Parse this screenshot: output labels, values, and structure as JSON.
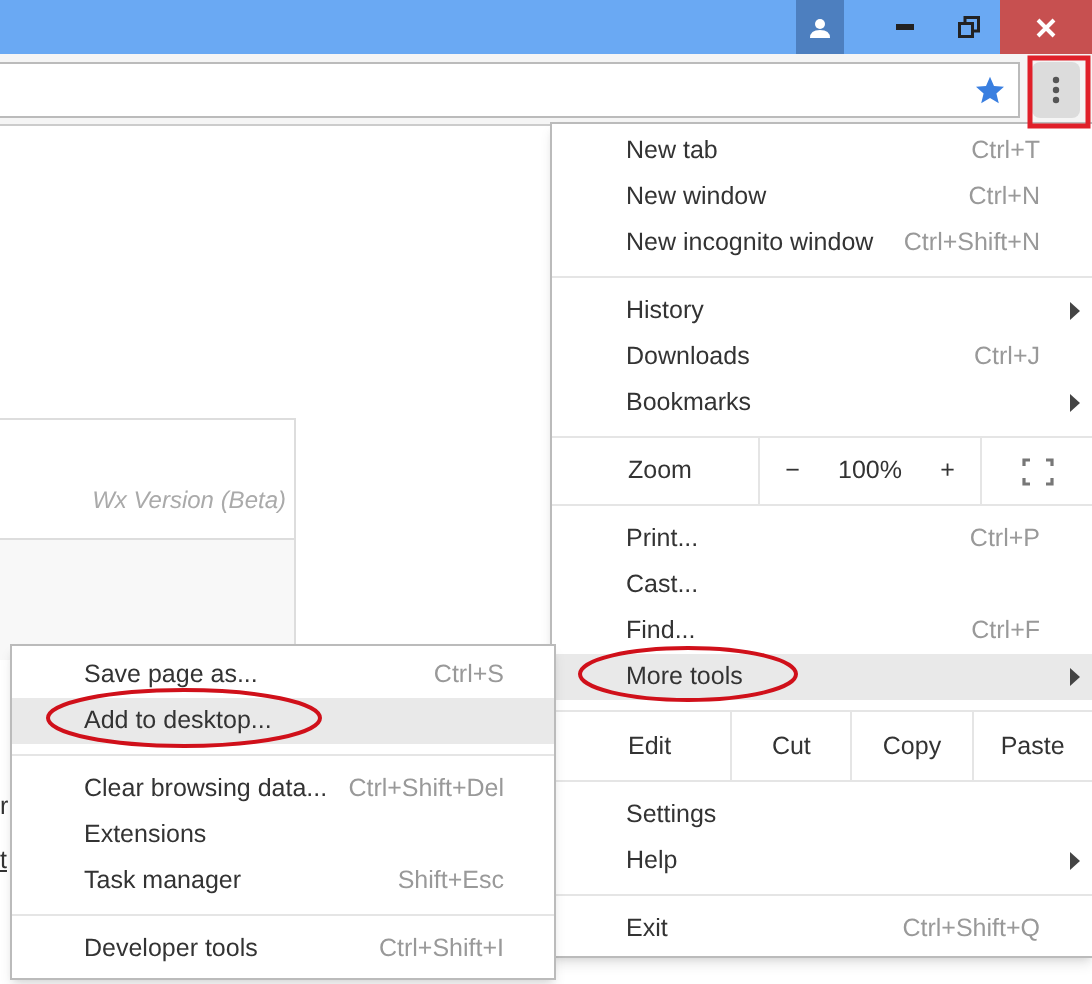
{
  "page": {
    "card_caption": "Wx Version (Beta)",
    "fragments": [
      {
        "text": "r",
        "kind": "text"
      },
      {
        "text": "t",
        "kind": "link"
      }
    ]
  },
  "menu": {
    "items": [
      {
        "kind": "item",
        "label": "New tab",
        "shortcut": "Ctrl+T",
        "submenu": false,
        "highlighted": false
      },
      {
        "kind": "item",
        "label": "New window",
        "shortcut": "Ctrl+N",
        "submenu": false,
        "highlighted": false
      },
      {
        "kind": "item",
        "label": "New incognito window",
        "shortcut": "Ctrl+Shift+N",
        "submenu": false,
        "highlighted": false
      },
      {
        "kind": "separator"
      },
      {
        "kind": "item",
        "label": "History",
        "submenu": true,
        "highlighted": false
      },
      {
        "kind": "item",
        "label": "Downloads",
        "shortcut": "Ctrl+J",
        "submenu": false,
        "highlighted": false
      },
      {
        "kind": "item",
        "label": "Bookmarks",
        "submenu": true,
        "highlighted": false
      },
      {
        "kind": "separator"
      },
      {
        "kind": "zoom",
        "label": "Zoom",
        "minus": "−",
        "value": "100%",
        "plus": "+"
      },
      {
        "kind": "separator"
      },
      {
        "kind": "item",
        "label": "Print...",
        "shortcut": "Ctrl+P",
        "submenu": false,
        "highlighted": false
      },
      {
        "kind": "item",
        "label": "Cast...",
        "submenu": false,
        "highlighted": false
      },
      {
        "kind": "item",
        "label": "Find...",
        "shortcut": "Ctrl+F",
        "submenu": false,
        "highlighted": false
      },
      {
        "kind": "item",
        "label": "More tools",
        "submenu": true,
        "highlighted": true
      },
      {
        "kind": "separator"
      },
      {
        "kind": "edit",
        "label": "Edit",
        "buttons": [
          "Cut",
          "Copy",
          "Paste"
        ]
      },
      {
        "kind": "separator"
      },
      {
        "kind": "item",
        "label": "Settings",
        "submenu": false,
        "highlighted": false
      },
      {
        "kind": "item",
        "label": "Help",
        "submenu": true,
        "highlighted": false
      },
      {
        "kind": "separator"
      },
      {
        "kind": "item",
        "label": "Exit",
        "shortcut": "Ctrl+Shift+Q",
        "submenu": false,
        "highlighted": false
      }
    ]
  },
  "submenu": {
    "items": [
      {
        "kind": "item",
        "label": "Save page as...",
        "shortcut": "Ctrl+S",
        "highlighted": false
      },
      {
        "kind": "item",
        "label": "Add to desktop...",
        "highlighted": true
      },
      {
        "kind": "separator"
      },
      {
        "kind": "item",
        "label": "Clear browsing data...",
        "shortcut": "Ctrl+Shift+Del",
        "highlighted": false
      },
      {
        "kind": "item",
        "label": "Extensions",
        "highlighted": false
      },
      {
        "kind": "item",
        "label": "Task manager",
        "shortcut": "Shift+Esc",
        "highlighted": false
      },
      {
        "kind": "separator"
      },
      {
        "kind": "item",
        "label": "Developer tools",
        "shortcut": "Ctrl+Shift+I",
        "highlighted": false
      }
    ]
  }
}
